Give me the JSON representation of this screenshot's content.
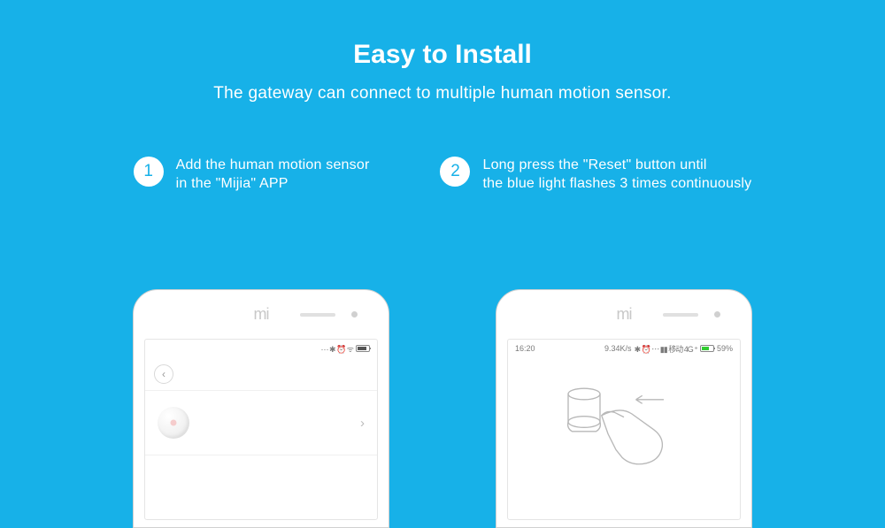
{
  "header": {
    "title": "Easy to Install",
    "subtitle": "The gateway can connect to multiple human motion sensor."
  },
  "steps": [
    {
      "num": "1",
      "text_line1": "Add the human motion sensor",
      "text_line2": " in the \"Mijia\" APP"
    },
    {
      "num": "2",
      "text_line1": "Long press the \"Reset\" button until",
      "text_line2": "the blue light flashes 3 times continuously"
    }
  ],
  "phone1": {
    "logo": "mi",
    "status_left": "",
    "status_icons": "⋯ ✱ ⏰ ᯤ",
    "signal": "▮▮▮▮"
  },
  "phone2": {
    "logo": "mi",
    "status_time": "16:20",
    "status_speed": "9.34K/s",
    "status_icons": "✱ ⏰ ⋯ ▮▮ 移动 4G ⁺",
    "status_battery": "59%"
  }
}
